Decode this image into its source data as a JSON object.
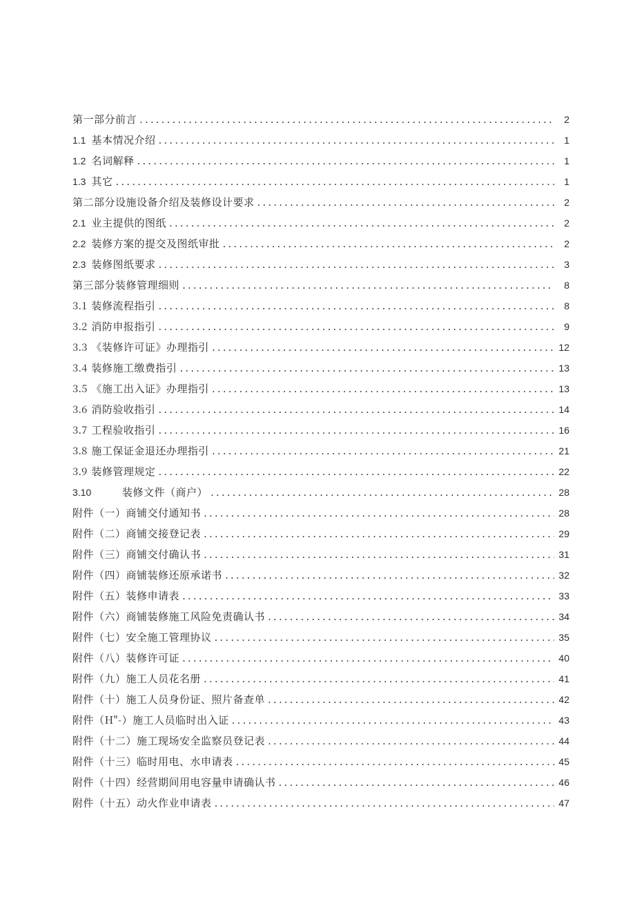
{
  "toc": [
    {
      "num": "",
      "title": "第一部分前言",
      "page": "2",
      "numClass": ""
    },
    {
      "num": "1.1",
      "title": "基本情况介绍",
      "page": "1",
      "numClass": "toc-num"
    },
    {
      "num": "1.2",
      "title": "名词解释",
      "page": "1",
      "numClass": "toc-num"
    },
    {
      "num": "1.3",
      "title": "其它",
      "page": "1",
      "numClass": "toc-num"
    },
    {
      "num": "",
      "title": "第二部分设施设备介绍及装修设计要求",
      "page": "2",
      "numClass": ""
    },
    {
      "num": "2.1",
      "title": "业主提供的图纸",
      "page": "2",
      "numClass": "toc-num"
    },
    {
      "num": "2.2",
      "title": "装修方案的提交及图纸审批",
      "page": "2",
      "numClass": "toc-num"
    },
    {
      "num": "2.3",
      "title": "装修图纸要求",
      "page": "3",
      "numClass": "toc-num"
    },
    {
      "num": "",
      "title": "第三部分装修管理细则",
      "page": "8",
      "numClass": ""
    },
    {
      "num": "3.1",
      "title": "装修流程指引",
      "page": "8",
      "numClass": "toc-num-zh"
    },
    {
      "num": "3.2",
      "title": "消防申报指引",
      "page": "9",
      "numClass": "toc-num-zh"
    },
    {
      "num": "3.3",
      "title": "《装修许可证》办理指引",
      "page": "12",
      "numClass": "toc-num-zh"
    },
    {
      "num": "3.4",
      "title": "装修施工缴费指引",
      "page": "13",
      "numClass": "toc-num-zh"
    },
    {
      "num": "3.5",
      "title": "《施工出入证》办理指引",
      "page": "13",
      "numClass": "toc-num-zh"
    },
    {
      "num": "3.6",
      "title": "消防验收指引",
      "page": "14",
      "numClass": "toc-num-zh"
    },
    {
      "num": "3.7",
      "title": "工程验收指引",
      "page": "16",
      "numClass": "toc-num-zh"
    },
    {
      "num": "3.8",
      "title": "施工保证金退还办理指引",
      "page": "21",
      "numClass": "toc-num-zh"
    },
    {
      "num": "3.9",
      "title": "装修管理规定",
      "page": "22",
      "numClass": "toc-num-zh"
    },
    {
      "num": "3.10",
      "title": "装修文件（商户）",
      "page": "28",
      "numClass": "toc-num-wide"
    },
    {
      "num": "",
      "title": "附件（一）商铺交付通知书",
      "page": "28",
      "numClass": ""
    },
    {
      "num": "",
      "title": "附件（二）商铺交接登记表",
      "page": "29",
      "numClass": ""
    },
    {
      "num": "",
      "title": "附件（三）商铺交付确认书",
      "page": "31",
      "numClass": ""
    },
    {
      "num": "",
      "title": "附件（四）商铺装修还原承诺书",
      "page": "32",
      "numClass": ""
    },
    {
      "num": "",
      "title": "附件（五）装修申请表",
      "page": "33",
      "numClass": ""
    },
    {
      "num": "",
      "title": "附件（六）商铺装修施工风险免责确认书",
      "page": "34",
      "numClass": ""
    },
    {
      "num": "",
      "title": "附件（七）安全施工管理协议",
      "page": "35",
      "numClass": ""
    },
    {
      "num": "",
      "title": "附件（八）装修许可证",
      "page": "40",
      "numClass": ""
    },
    {
      "num": "",
      "title": "附件（九）施工人员花名册",
      "page": "41",
      "numClass": ""
    },
    {
      "num": "",
      "title": "附件（十）施工人员身份证、照片备查单",
      "page": "42",
      "numClass": ""
    },
    {
      "num": "",
      "title": "附件（H\"-）施工人员临时出入证",
      "page": "43",
      "numClass": ""
    },
    {
      "num": "",
      "title": "附件（十二）施工现场安全监察员登记表",
      "page": "44",
      "numClass": ""
    },
    {
      "num": "",
      "title": "附件（十三）临时用电、水申请表",
      "page": "45",
      "numClass": ""
    },
    {
      "num": "",
      "title": "附件（十四）经营期间用电容量申请确认书",
      "page": "46",
      "numClass": ""
    },
    {
      "num": "",
      "title": "附件（十五）动火作业申请表",
      "page": "47",
      "numClass": ""
    }
  ]
}
